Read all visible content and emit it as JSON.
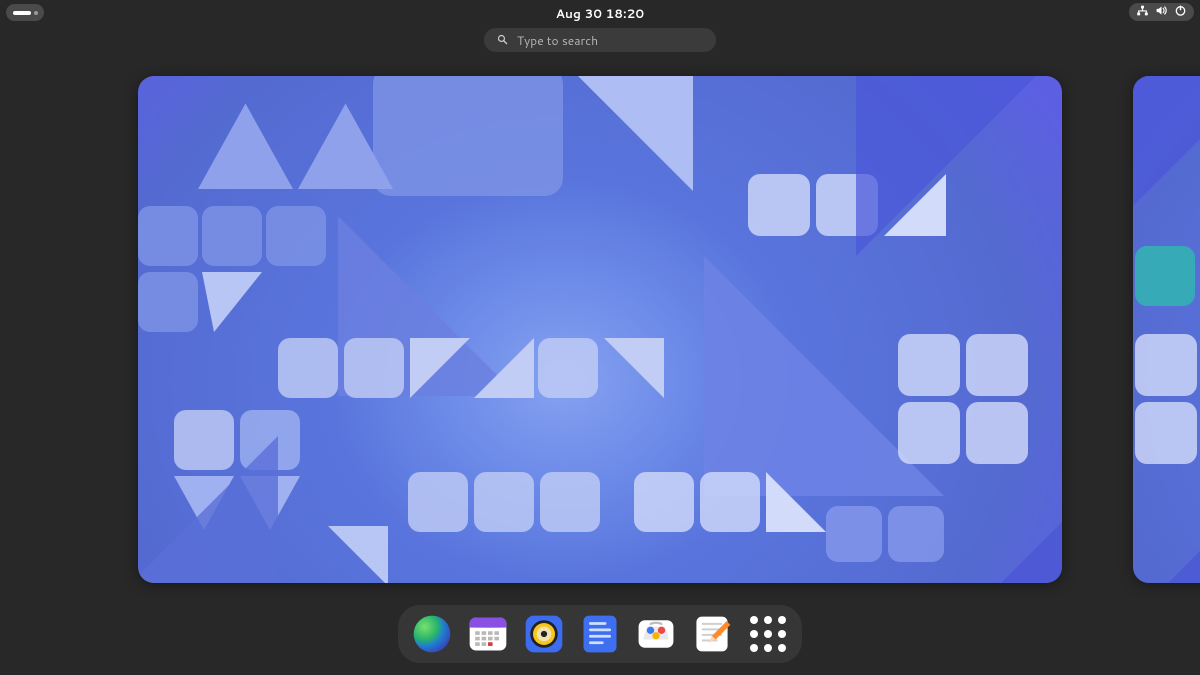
{
  "topbar": {
    "clock": "Aug 30  18:20"
  },
  "search": {
    "placeholder": "Type to search"
  },
  "system_icons": {
    "network": "network-icon",
    "volume": "volume-icon",
    "power": "power-icon"
  },
  "dash": {
    "apps": [
      {
        "name": "web-browser",
        "label": "Web Browser"
      },
      {
        "name": "calendar",
        "label": "Calendar"
      },
      {
        "name": "music",
        "label": "Music"
      },
      {
        "name": "files",
        "label": "Files"
      },
      {
        "name": "software",
        "label": "Software"
      },
      {
        "name": "text-editor",
        "label": "Text Editor"
      }
    ],
    "show_apps_label": "Show Apps"
  }
}
